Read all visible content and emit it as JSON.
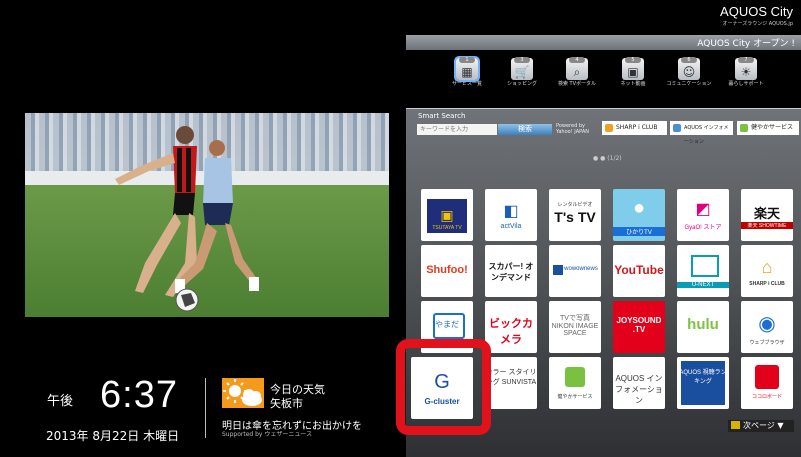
{
  "brand": {
    "title": "AQUOS City",
    "subtitle": "オーナーズラウンジ AQUOS.jp"
  },
  "topbar": {
    "text": "AQUOS City オープン !"
  },
  "categories": [
    {
      "num": "1",
      "label": "サービス一覧",
      "icon": "grid-icon",
      "selected": true
    },
    {
      "num": "3",
      "label": "ショッピング",
      "icon": "cart-icon"
    },
    {
      "num": "4",
      "label": "検索 TVポータル",
      "icon": "search-icon"
    },
    {
      "num": "5",
      "label": "ネット動画",
      "icon": "film-icon"
    },
    {
      "num": "6",
      "label": "コミュニケーション",
      "icon": "chat-icon"
    },
    {
      "num": "7",
      "label": "暮らしサポート",
      "icon": "support-icon"
    }
  ],
  "smart_search": {
    "label": "Smart Search",
    "placeholder": "キーワードを入力",
    "button": "検索",
    "powered_line1": "Powered by",
    "powered_line2": "Yahoo! JAPAN",
    "chips": [
      {
        "label": "SHARP i CLUB",
        "color": "#f0a020"
      },
      {
        "label": "AQUOS インフォメーション",
        "color": "#4a8fd8"
      },
      {
        "label": "健やかサービス",
        "color": "#7ac142"
      }
    ],
    "pager": "● ● (1/2)"
  },
  "apps": [
    {
      "label": "TSUTAYA TV",
      "bg": "#1f2d7a",
      "fg": "#f5c400"
    },
    {
      "label": "actVila",
      "bg": "#ffffff",
      "fg": "#1a5fb4"
    },
    {
      "label": "T's TV",
      "bg": "#ffffff",
      "fg": "#111111"
    },
    {
      "label": "ひかりTV",
      "bg": "#7fcdea",
      "fg": "#ffffff"
    },
    {
      "label": "GyaO! ストア",
      "bg": "#ffffff",
      "fg": "#e0007a"
    },
    {
      "label": "楽天 SHOWTIME",
      "bg": "#ffffff",
      "fg": "#bf0000"
    },
    {
      "label": "Shufoo!",
      "bg": "#ffffff",
      "fg": "#e23a1e"
    },
    {
      "label": "スカパー! オンデマンド",
      "bg": "#ffffff",
      "fg": "#111111"
    },
    {
      "label": "wowownews",
      "bg": "#ffffff",
      "fg": "#1b4fa0"
    },
    {
      "label": "YouTube",
      "bg": "#ffffff",
      "fg": "#cc181e"
    },
    {
      "label": "U-NEXT",
      "bg": "#ffffff",
      "fg": "#0a9bb5"
    },
    {
      "label": "SHARP i CLUB",
      "bg": "#ffffff",
      "fg": "#333333"
    },
    {
      "label": "やまだ",
      "bg": "#ffffff",
      "fg": "#1a6fd6"
    },
    {
      "label": "ビックカメラ",
      "bg": "#ffffff",
      "fg": "#e2001a"
    },
    {
      "label": "TVで写真 NIKON IMAGE SPACE",
      "bg": "#ffffff",
      "fg": "#666666"
    },
    {
      "label": "JOYSOUND .TV",
      "bg": "#e2001a",
      "fg": "#ffffff"
    },
    {
      "label": "hulu",
      "bg": "#ffffff",
      "fg": "#7fc241"
    },
    {
      "label": "ウェブブラウザ",
      "bg": "#ffffff",
      "fg": "#1a6fd6"
    },
    {
      "label": "G-cluster",
      "bg": "#ffffff",
      "fg": "#1a4fa0"
    },
    {
      "label": "カラー スタイリング SUNVISTA",
      "bg": "#ffffff",
      "fg": "#d4006e"
    },
    {
      "label": "健やかサービス",
      "bg": "#ffffff",
      "fg": "#7ac142"
    },
    {
      "label": "AQUOS インフォメーション",
      "bg": "#ffffff",
      "fg": "#333333"
    },
    {
      "label": "AQUOS 視聴ランキング",
      "bg": "#ffffff",
      "fg": "#1a4fa0"
    },
    {
      "label": "ココロボード",
      "bg": "#ffffff",
      "fg": "#e2001a"
    }
  ],
  "next": {
    "label": "次ページ ▼"
  },
  "clock": {
    "ampm": "午後",
    "time": "6:37",
    "date": "2013年 8月22日 木曜日"
  },
  "weather": {
    "title": "今日の天気",
    "city": "矢板市",
    "message": "明日は傘を忘れずにお出かけを",
    "supported": "Supported by ウェザーニュース"
  }
}
